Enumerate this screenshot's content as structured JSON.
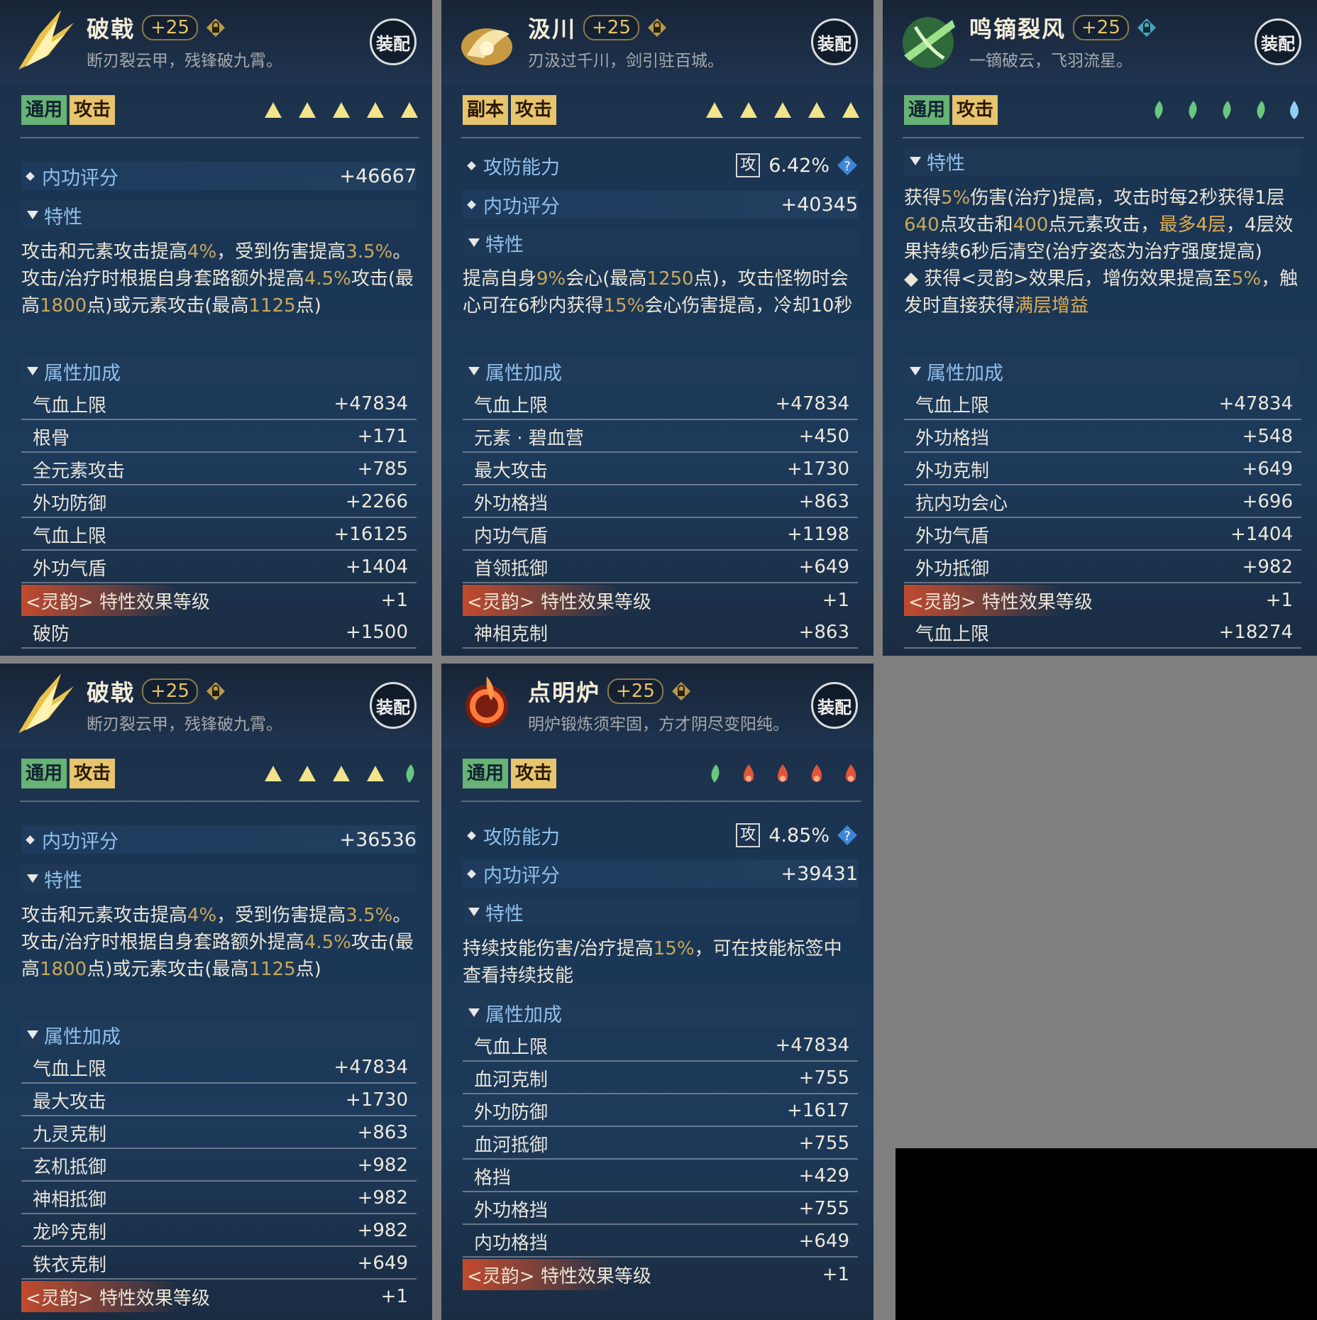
{
  "panels": [
    {
      "name": "破戟",
      "level": "+25",
      "desc": "断刃裂云甲，残锋破九霄。",
      "equip": "装配",
      "tags": [
        "通用",
        "攻击"
      ],
      "score_label": "内功评分",
      "score": "+46667",
      "trait_label": "特性",
      "trait_html": "攻击和元素攻击提高<span class='n'>4%</span>，受到伤害提高<span class='n'>3.5%</span>。攻击/治疗时根据自身套路额外提高<span class='n'>4.5%</span>攻击(最高<span class='n'>1800</span>点)或元素攻击(最高<span class='n'>1125</span>点)",
      "attr_label": "属性加成",
      "attrs": [
        [
          "气血上限",
          "+47834"
        ],
        [
          "根骨",
          "+171"
        ],
        [
          "全元素攻击",
          "+785"
        ],
        [
          "外功防御",
          "+2266"
        ],
        [
          "气血上限",
          "+16125"
        ],
        [
          "外功气盾",
          "+1404"
        ],
        [
          "<灵韵> 特性效果等级",
          "+1"
        ],
        [
          "破防",
          "+1500"
        ]
      ]
    },
    {
      "name": "汲川",
      "level": "+25",
      "desc": "刃汲过千川，剑引驻百城。",
      "equip": "装配",
      "tags": [
        "副本",
        "攻击"
      ],
      "power_label": "攻防能力",
      "power_icon": "攻",
      "power": "6.42%",
      "score_label": "内功评分",
      "score": "+40345",
      "trait_label": "特性",
      "trait_html": "提高自身<span class='n'>9%</span>会心(最高<span class='n'>1250</span>点)，攻击怪物时会心可在6秒内获得<span class='n'>15%</span>会心伤害提高，冷却10秒",
      "attr_label": "属性加成",
      "attrs": [
        [
          "气血上限",
          "+47834"
        ],
        [
          "元素 · 碧血营",
          "+450"
        ],
        [
          "最大攻击",
          "+1730"
        ],
        [
          "外功格挡",
          "+863"
        ],
        [
          "内功气盾",
          "+1198"
        ],
        [
          "首领抵御",
          "+649"
        ],
        [
          "<灵韵> 特性效果等级",
          "+1"
        ],
        [
          "神相克制",
          "+863"
        ]
      ]
    },
    {
      "name": "鸣镝裂风",
      "level": "+25",
      "desc": "一镝破云，飞羽流星。",
      "equip": "装配",
      "tags": [
        "通用",
        "攻击"
      ],
      "trait_label": "特性",
      "trait_html": "获得<span class='n'>5%</span>伤害(治疗)提高，攻击时每2秒获得1层<span class='n'>640</span>点攻击和<span class='n'>400</span>点元素攻击，<span class='o'>最多4层</span>，4层效果持续6秒后清空(治疗姿态为治疗强度提高)<br>◆ 获得<灵韵>效果后，增伤效果提高至<span class='n'>5%</span>，触发时直接获得<span class='o'>满层增益</span>",
      "attr_label": "属性加成",
      "attrs": [
        [
          "气血上限",
          "+47834"
        ],
        [
          "外功格挡",
          "+548"
        ],
        [
          "外功克制",
          "+649"
        ],
        [
          "抗内功会心",
          "+696"
        ],
        [
          "外功气盾",
          "+1404"
        ],
        [
          "外功抵御",
          "+982"
        ],
        [
          "<灵韵> 特性效果等级",
          "+1"
        ],
        [
          "气血上限",
          "+18274"
        ]
      ]
    },
    {
      "name": "破戟",
      "level": "+25",
      "desc": "断刃裂云甲，残锋破九霄。",
      "equip": "装配",
      "tags": [
        "通用",
        "攻击"
      ],
      "score_label": "内功评分",
      "score": "+36536",
      "trait_label": "特性",
      "trait_html": "攻击和元素攻击提高<span class='n'>4%</span>，受到伤害提高<span class='n'>3.5%</span>。攻击/治疗时根据自身套路额外提高<span class='n'>4.5%</span>攻击(最高<span class='n'>1800</span>点)或元素攻击(最高<span class='n'>1125</span>点)",
      "attr_label": "属性加成",
      "attrs": [
        [
          "气血上限",
          "+47834"
        ],
        [
          "最大攻击",
          "+1730"
        ],
        [
          "九灵克制",
          "+863"
        ],
        [
          "玄机抵御",
          "+982"
        ],
        [
          "神相抵御",
          "+982"
        ],
        [
          "龙吟克制",
          "+982"
        ],
        [
          "铁衣克制",
          "+649"
        ],
        [
          "<灵韵> 特性效果等级",
          "+1"
        ]
      ]
    },
    {
      "name": "点明炉",
      "level": "+25",
      "desc": "明炉锻炼须牢固，方才阴尽变阳纯。",
      "equip": "装配",
      "tags": [
        "通用",
        "攻击"
      ],
      "power_label": "攻防能力",
      "power_icon": "攻",
      "power": "4.85%",
      "score_label": "内功评分",
      "score": "+39431",
      "trait_label": "特性",
      "trait_html": "持续技能伤害/治疗提高<span class='n'>15%</span>，可在技能标签中查看持续技能",
      "attr_label": "属性加成",
      "attrs": [
        [
          "气血上限",
          "+47834"
        ],
        [
          "血河克制",
          "+755"
        ],
        [
          "外功防御",
          "+1617"
        ],
        [
          "血河抵御",
          "+755"
        ],
        [
          "格挡",
          "+429"
        ],
        [
          "外功格挡",
          "+755"
        ],
        [
          "内功格挡",
          "+649"
        ],
        [
          "<灵韵> 特性效果等级",
          "+1"
        ]
      ]
    }
  ]
}
